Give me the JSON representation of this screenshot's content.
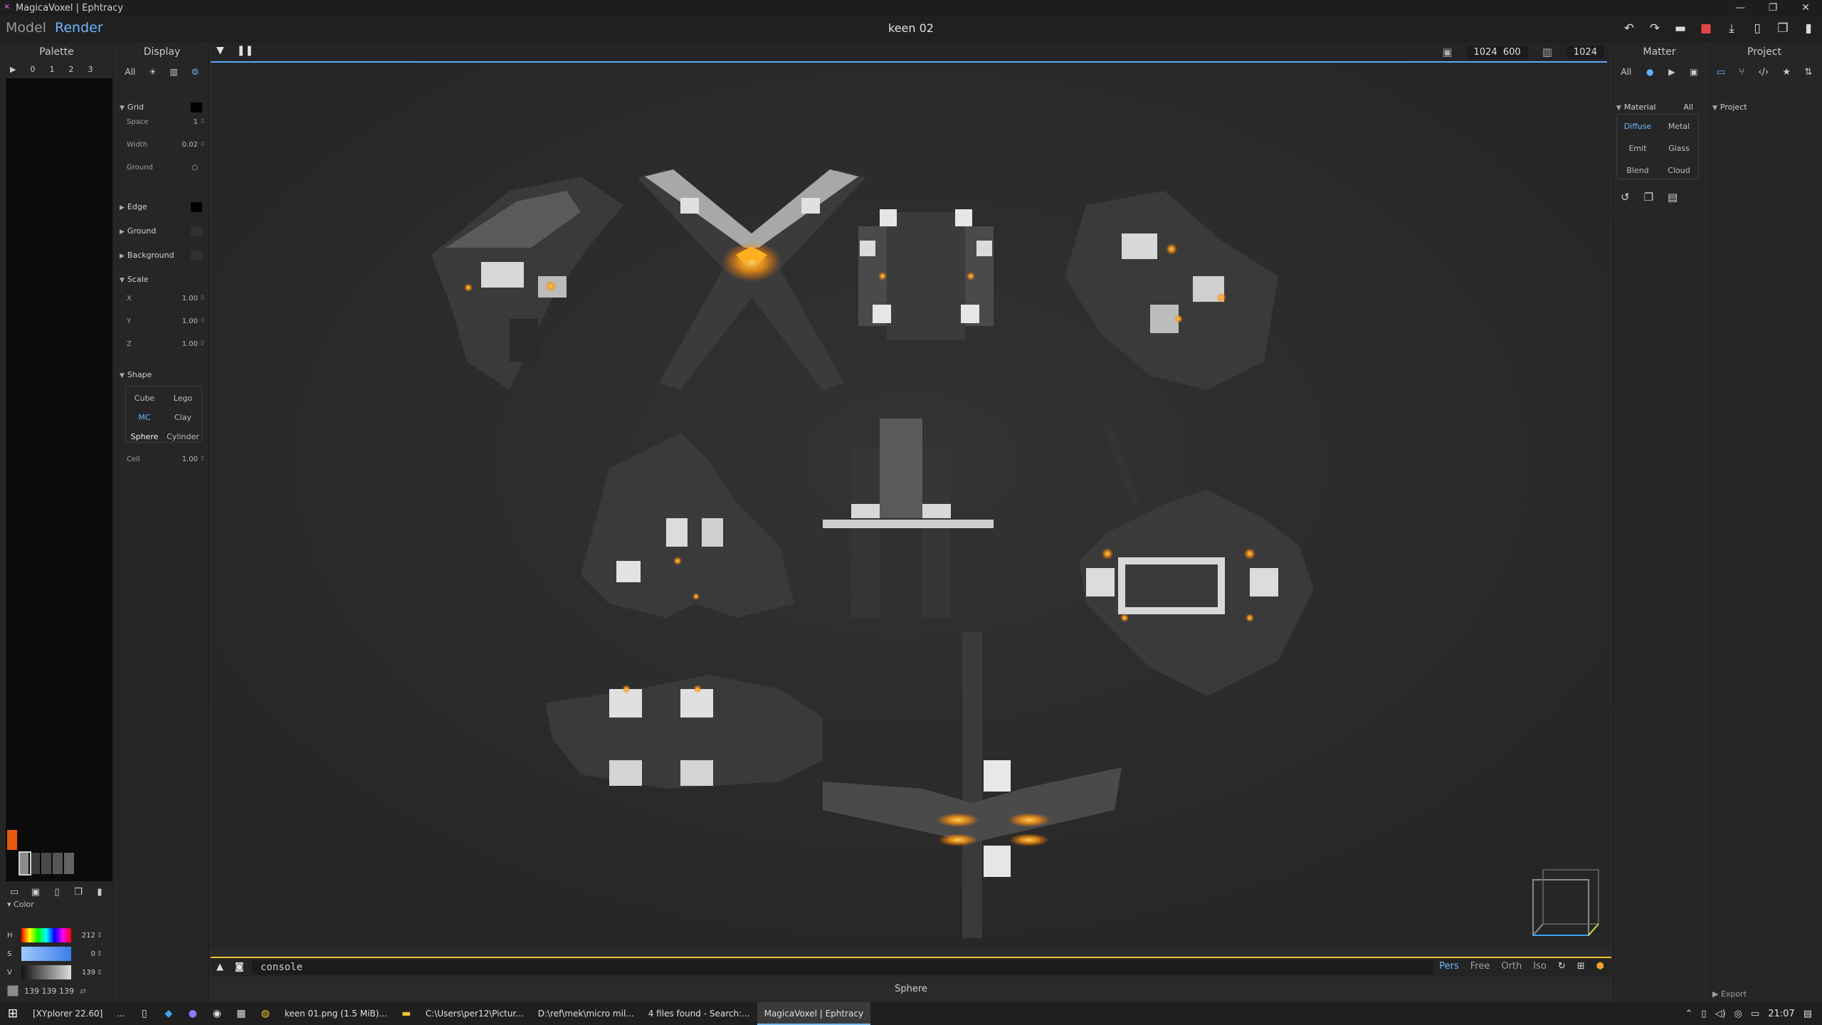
{
  "window": {
    "title": "MagicaVoxel | Ephtracy",
    "controls": [
      "—",
      "❐",
      "✕"
    ]
  },
  "menubar": {
    "model_tab": "Model",
    "render_tab": "Render",
    "file_title": "keen 02"
  },
  "palette": {
    "title": "Palette",
    "pages": [
      "▶",
      "0",
      "1",
      "2",
      "3"
    ],
    "colors": {
      "orange": "#e85a12",
      "greys": [
        "#8b8b8b",
        "#3c3c3c",
        "#4a4a4a",
        "#565656",
        "#636363"
      ]
    }
  },
  "color": {
    "header": "Color",
    "h": {
      "label": "H",
      "value": "212"
    },
    "s": {
      "label": "S",
      "value": "0"
    },
    "v": {
      "label": "V",
      "value": "139"
    },
    "rgb": "139  139  139"
  },
  "display": {
    "title": "Display",
    "all_label": "All",
    "grid": {
      "label": "Grid",
      "color": "#000000"
    },
    "space": {
      "label": "Space",
      "value": "1"
    },
    "width": {
      "label": "Width",
      "value": "0.02"
    },
    "ground_prop": {
      "label": "Ground",
      "value": "○"
    },
    "edge": {
      "label": "Edge",
      "color": "#000000"
    },
    "ground": {
      "label": "Ground",
      "color": "#303030"
    },
    "background": {
      "label": "Background",
      "color": "#303030"
    },
    "scale": {
      "label": "Scale",
      "x_label": "X",
      "x": "1.00",
      "y_label": "Y",
      "y": "1.00",
      "z_label": "Z",
      "z": "1.00"
    },
    "shape": {
      "label": "Shape",
      "options": [
        "Cube",
        "Lego",
        "MC",
        "Clay",
        "Sphere",
        "Cylinder"
      ],
      "selected": "MC"
    },
    "cell": {
      "label": "Cell",
      "value": "1.00"
    }
  },
  "viewport_toolbar": {
    "width": "1024",
    "height": "600",
    "sample": "1024"
  },
  "console": {
    "text": "console",
    "views": [
      "Pers",
      "Free",
      "Orth",
      "Iso"
    ],
    "active_view": "Pers"
  },
  "status": "Sphere",
  "matter": {
    "title": "Matter",
    "all_label": "All",
    "material_label": "Material",
    "material_all": "All",
    "types": [
      "Diffuse",
      "Metal",
      "Emit",
      "Glass",
      "Blend",
      "Cloud"
    ],
    "selected": "Diffuse"
  },
  "project": {
    "title": "Project",
    "tree_root": "Project",
    "export_label": "Export"
  },
  "taskbar": {
    "tasks": [
      "[XYplorer 22.60]",
      "...",
      "keen 01.png (1.5 MiB)...",
      "C:\\Users\\per12\\Pictur...",
      "D:\\ref\\mek\\micro mil...",
      "4 files found - Search:...",
      "MagicaVoxel | Ephtracy"
    ],
    "clock": "21:07"
  },
  "scene": {
    "accent_glow": "#ffb020",
    "metal_light": "#e8e8e8",
    "metal_dark": "#2f2f2f"
  }
}
